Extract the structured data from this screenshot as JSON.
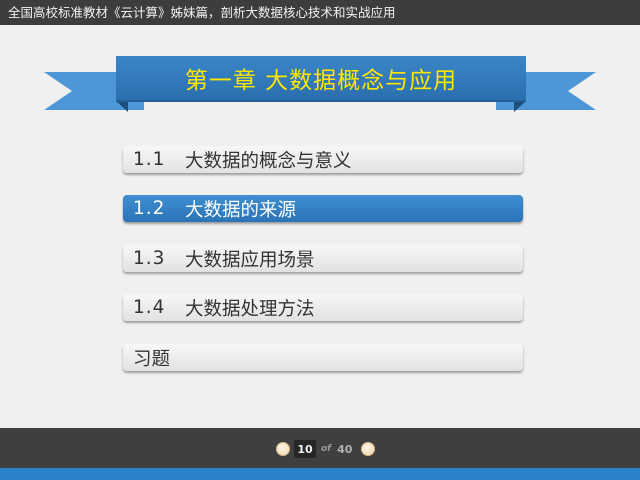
{
  "header": {
    "text": "全国高校标准教材《云计算》姊妹篇，剖析大数据核心技术和实战应用"
  },
  "chapter": {
    "title": "第一章   大数据概念与应用"
  },
  "menu": {
    "items": [
      {
        "number": "1.1",
        "label": "大数据的概念与意义"
      },
      {
        "number": "1.2",
        "label": "大数据的来源"
      },
      {
        "number": "1.3",
        "label": "大数据应用场景"
      },
      {
        "number": "1.4",
        "label": "大数据处理方法"
      },
      {
        "number": "",
        "label": "习题"
      }
    ],
    "active_index": 1
  },
  "pager": {
    "current": "10",
    "of": "of",
    "total": "40"
  },
  "colors": {
    "topbar": "#3d3d3d",
    "ribbon": "#2a6fae",
    "ribbon_title": "#ffe600",
    "active_item": "#2b74b7",
    "footer": "#3f3f3f",
    "footer_strip": "#2b82c9"
  },
  "icons": {
    "prev": "prev-page-dot-icon",
    "next": "next-page-dot-icon"
  }
}
